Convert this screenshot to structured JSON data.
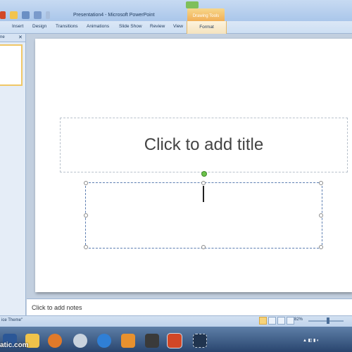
{
  "window": {
    "title": "Presentation4 - Microsoft PowerPoint",
    "contextual_group": "Drawing Tools"
  },
  "ribbon": {
    "tabs": [
      "Insert",
      "Design",
      "Transitions",
      "Animations",
      "Slide Show",
      "Review",
      "View"
    ],
    "format_tab": "Format"
  },
  "left_pane": {
    "header_text": "ne",
    "close_glyph": "✕"
  },
  "slide": {
    "title_placeholder": "Click to add title"
  },
  "notes": {
    "placeholder": "Click to add notes"
  },
  "status": {
    "theme": "ice Theme\"",
    "zoom": "82%"
  },
  "taskbar": {
    "watermark": "atic.com"
  },
  "colors": {
    "accent_drawing_tools": "#f0a84e",
    "ribbon_blue": "#cddff3",
    "taskbar": "#29456e"
  }
}
